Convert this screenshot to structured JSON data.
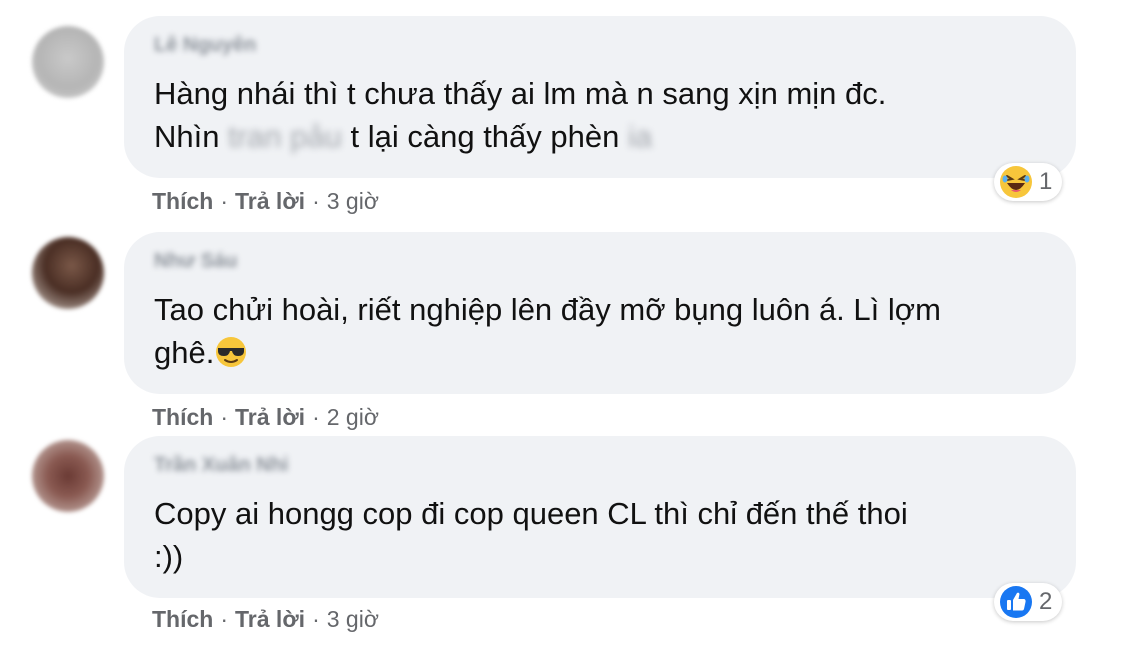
{
  "comments": [
    {
      "author": "Lê Nguyên",
      "line1": "Hàng nhái thì t chưa thấy ai lm mà n sang xịn mịn đc.",
      "line2_prefix": "Nhìn",
      "line2_blur": "tran pảu",
      "line2_text": "t lại càng thấy phèn",
      "line2_tail": "ia",
      "actions": {
        "like": "Thích",
        "reply": "Trả lời",
        "time": "3 giờ"
      },
      "reaction": {
        "icon": "laughing-emoji",
        "count": "1"
      }
    },
    {
      "author": "Như Sáu",
      "line1": "Tao chửi hoài, riết nghiệp lên đầy mỡ bụng luôn á. Lì lợm",
      "line2": "ghê.",
      "inline_emoji": "sunglasses-emoji",
      "actions": {
        "like": "Thích",
        "reply": "Trả lời",
        "time": "2 giờ"
      }
    },
    {
      "author": "Trần Xuân Nhi",
      "line1": "Copy ai hongg cop đi cop queen CL thì chỉ đến thế thoi",
      "line2": ":))",
      "actions": {
        "like": "Thích",
        "reply": "Trả lời",
        "time": "3 giờ"
      },
      "reaction": {
        "icon": "like-icon",
        "count": "2",
        "color": "#1877f2"
      }
    }
  ],
  "colors": {
    "bubble": "#f0f2f5",
    "meta": "#65676b",
    "like_blue": "#1877f2"
  }
}
